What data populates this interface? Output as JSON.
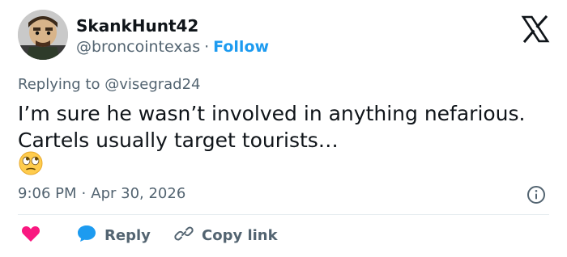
{
  "author": {
    "display_name": "SkankHunt42",
    "handle": "@broncointexas",
    "follow_label": "Follow",
    "separator": "·"
  },
  "reply_context": {
    "prefix": "Replying to",
    "mention": "@visegrad24"
  },
  "tweet": {
    "lines": [
      "I’m sure he wasn’t involved in anything nefarious.",
      "Cartels usually target tourists…"
    ],
    "emoji": "face-with-rolling-eyes"
  },
  "meta": {
    "time": "9:06 PM",
    "separator": "·",
    "date": "Apr 30, 2026"
  },
  "actions": {
    "reply_label": "Reply",
    "copy_label": "Copy link"
  },
  "icons": {
    "brand": "x-logo",
    "info": "info-icon",
    "like": "heart-icon",
    "reply": "chat-bubble-icon",
    "copy": "link-icon"
  },
  "colors": {
    "accent": "#1d9bf0",
    "heart": "#f91880",
    "text": "#0f1419",
    "muted": "#536471"
  }
}
